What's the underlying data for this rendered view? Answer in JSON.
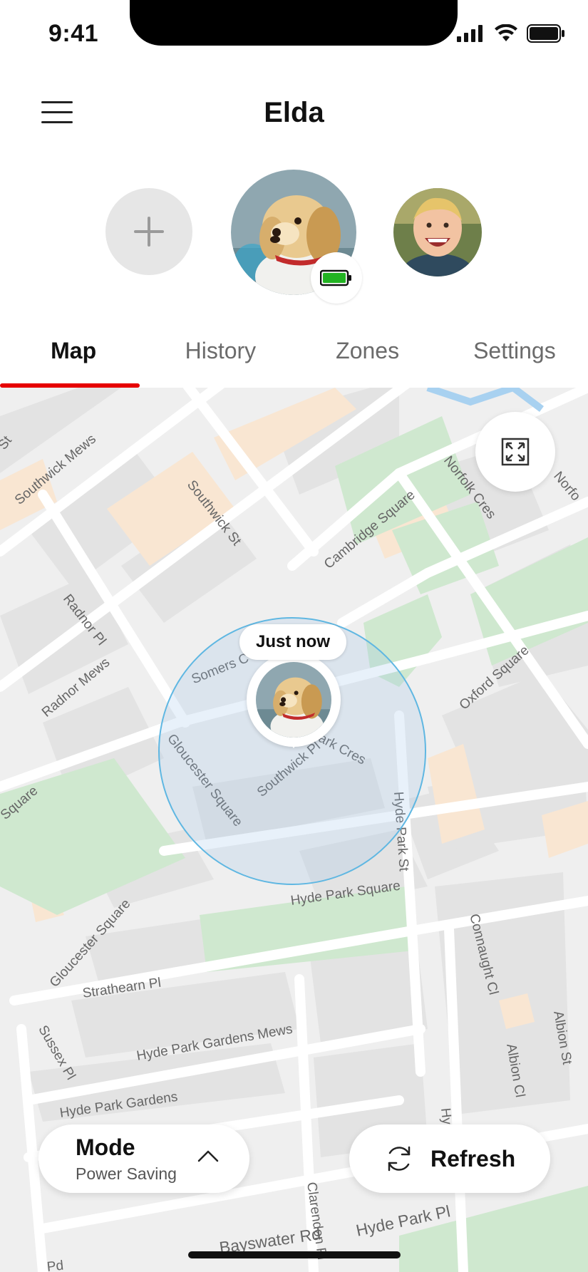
{
  "status_bar": {
    "time": "9:41"
  },
  "header": {
    "title": "Elda",
    "menu_icon": "hamburger-menu-icon"
  },
  "profiles": {
    "add_icon": "plus-icon",
    "selected": {
      "name": "dog-profile-avatar",
      "battery_icon": "battery-full-icon",
      "battery_color": "#22b322"
    },
    "other": {
      "name": "child-profile-avatar"
    }
  },
  "tabs": [
    {
      "label": "Map",
      "active": true
    },
    {
      "label": "History",
      "active": false
    },
    {
      "label": "Zones",
      "active": false
    },
    {
      "label": "Settings",
      "active": false
    }
  ],
  "map": {
    "expand_icon": "expand-arrows-icon",
    "last_seen": "Just now",
    "streets": [
      "St",
      "Southwick Mews",
      "Southwick St",
      "Cambridge Square",
      "Norfolk Cres",
      "Norfo",
      "Radnor Pl",
      "Radnor Mews",
      "Somers C",
      "Oxford Square",
      "Gloucester Square",
      "Southwick Pl",
      "ark Cres",
      "Square",
      "Hyde Park St",
      "Hyde Park Square",
      "Gloucester Square",
      "Connaught Cl",
      "Strathearn Pl",
      "Albion St",
      "Sussex Pl",
      "Albion Cl",
      "Hyde Park Gardens Mews",
      "Hyde Park Gardens",
      "Hy",
      "Clarendon Pl",
      "Hyde Park Pl",
      "Bayswater Rd",
      "Pd"
    ]
  },
  "mode": {
    "title": "Mode",
    "value": "Power Saving",
    "chevron_icon": "chevron-up-icon"
  },
  "refresh": {
    "label": "Refresh",
    "icon": "refresh-icon"
  },
  "colors": {
    "accent": "#e60000",
    "zone": "#5fb7e2",
    "park": "#cfe8cf",
    "building": "#fbe6cf"
  }
}
